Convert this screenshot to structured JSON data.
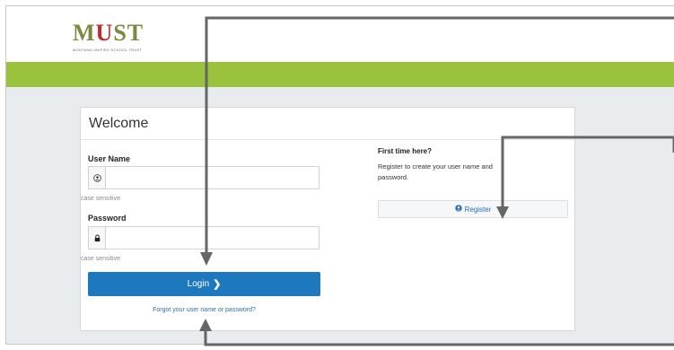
{
  "logo": {
    "word_start": "M",
    "word_apple": "U",
    "word_end": "ST",
    "tagline": "MONTANA UNIFIED SCHOOL TRUST"
  },
  "card": {
    "title": "Welcome"
  },
  "login": {
    "username_label": "User Name",
    "username_hint": "case sensitive",
    "password_label": "Password",
    "password_hint": "case sensitive",
    "button_label": "Login",
    "forgot_link": "Forgot your user name or password?"
  },
  "register": {
    "heading": "First time here?",
    "text": "Register to create your user name and password.",
    "button_label": "Register"
  },
  "colors": {
    "accent_green": "#9bc23c",
    "primary_blue": "#1e78bd",
    "link_blue": "#2a6fb0",
    "callout": "#666666"
  },
  "icons": {
    "user": "user-icon",
    "lock": "lock-icon",
    "chevron": "chevron-right-icon"
  }
}
